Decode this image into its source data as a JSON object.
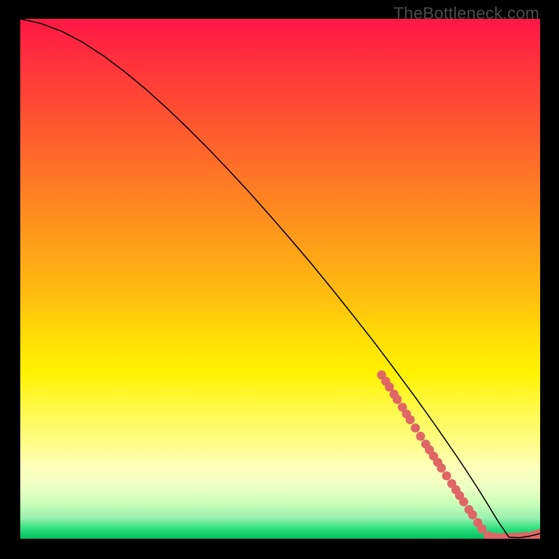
{
  "watermark": "TheBottleneck.com",
  "colors": {
    "dot": "#e06666",
    "curve": "#000000"
  },
  "chart_data": {
    "type": "line",
    "title": "",
    "xlabel": "",
    "ylabel": "",
    "xlim": [
      0,
      100
    ],
    "ylim": [
      0,
      100
    ],
    "grid": false,
    "curve": {
      "x": [
        0,
        4,
        8,
        12,
        16,
        20,
        24,
        28,
        32,
        36,
        40,
        44,
        48,
        52,
        56,
        60,
        64,
        68,
        72,
        76,
        80,
        82,
        84,
        86,
        88,
        90,
        92,
        94,
        96,
        98,
        100
      ],
      "y": [
        100,
        99.1,
        97.6,
        95.5,
        92.9,
        89.9,
        86.6,
        83.0,
        79.2,
        75.2,
        71.0,
        66.7,
        62.2,
        57.6,
        52.9,
        48.0,
        43.0,
        37.9,
        32.6,
        27.2,
        21.6,
        18.7,
        15.8,
        12.8,
        9.7,
        6.5,
        3.2,
        0.3,
        0.2,
        0.5,
        1.0
      ]
    },
    "series": [
      {
        "name": "dots",
        "type": "scatter",
        "marker": "circle",
        "color": "#e06666",
        "x": [
          69.5,
          70.3,
          71.0,
          71.9,
          72.5,
          73.5,
          74.3,
          75.0,
          76.0,
          77.0,
          78.0,
          78.7,
          79.5,
          80.3,
          81.0,
          82.0,
          83.0,
          83.8,
          84.5,
          85.3,
          86.3,
          87.0,
          88.0,
          88.8,
          90.0,
          90.7,
          91.3,
          92.0,
          93.0,
          93.8,
          94.5,
          95.3,
          96.3,
          97.2,
          98.5,
          99.3,
          100.0
        ],
        "y": [
          31.5,
          30.3,
          29.2,
          27.8,
          26.8,
          25.3,
          24.0,
          22.9,
          21.3,
          19.7,
          18.2,
          17.1,
          15.9,
          14.7,
          13.6,
          12.1,
          10.6,
          9.4,
          8.3,
          7.1,
          5.6,
          4.6,
          3.1,
          1.9,
          0.6,
          0.3,
          0.25,
          0.2,
          0.2,
          0.2,
          0.25,
          0.3,
          0.35,
          0.45,
          0.6,
          0.8,
          1.0
        ]
      }
    ]
  }
}
